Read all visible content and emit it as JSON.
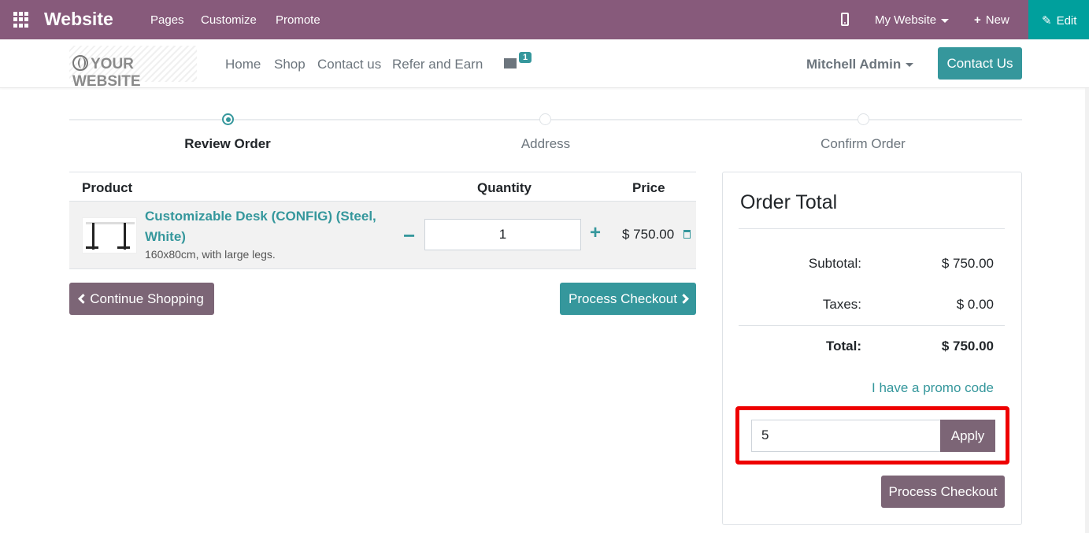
{
  "adminbar": {
    "brand": "Website",
    "menu": [
      "Pages",
      "Customize",
      "Promote"
    ],
    "site_selector": "My Website",
    "new_label": "New",
    "edit_label": "Edit"
  },
  "header": {
    "logo_text": "YOUR WEBSITE",
    "nav": [
      "Home",
      "Shop",
      "Contact us",
      "Refer and Earn"
    ],
    "cart_count": "1",
    "user": "Mitchell Admin",
    "contact_button": "Contact Us"
  },
  "wizard": {
    "steps": [
      "Review Order",
      "Address",
      "Confirm Order"
    ],
    "active": "Review Order"
  },
  "cart": {
    "columns": {
      "product": "Product",
      "quantity": "Quantity",
      "price": "Price"
    },
    "line": {
      "name": "Customizable Desk (CONFIG) (Steel, White)",
      "description": "160x80cm, with large legs.",
      "quantity": "1",
      "price": "$ 750.00"
    },
    "continue_label": "Continue Shopping",
    "checkout_label": "Process Checkout"
  },
  "order_total": {
    "title": "Order Total",
    "subtotal_label": "Subtotal:",
    "subtotal": "$ 750.00",
    "taxes_label": "Taxes:",
    "taxes": "$ 0.00",
    "total_label": "Total:",
    "total": "$ 750.00",
    "promo_link": "I have a promo code",
    "promo_value": "5",
    "apply_label": "Apply",
    "checkout_label": "Process Checkout"
  },
  "colors": {
    "admin_bar": "#875a7b",
    "edit_button": "#00a09d",
    "primary": "#35979c",
    "secondary": "#7c6576",
    "highlight_box": "#ee0000"
  }
}
